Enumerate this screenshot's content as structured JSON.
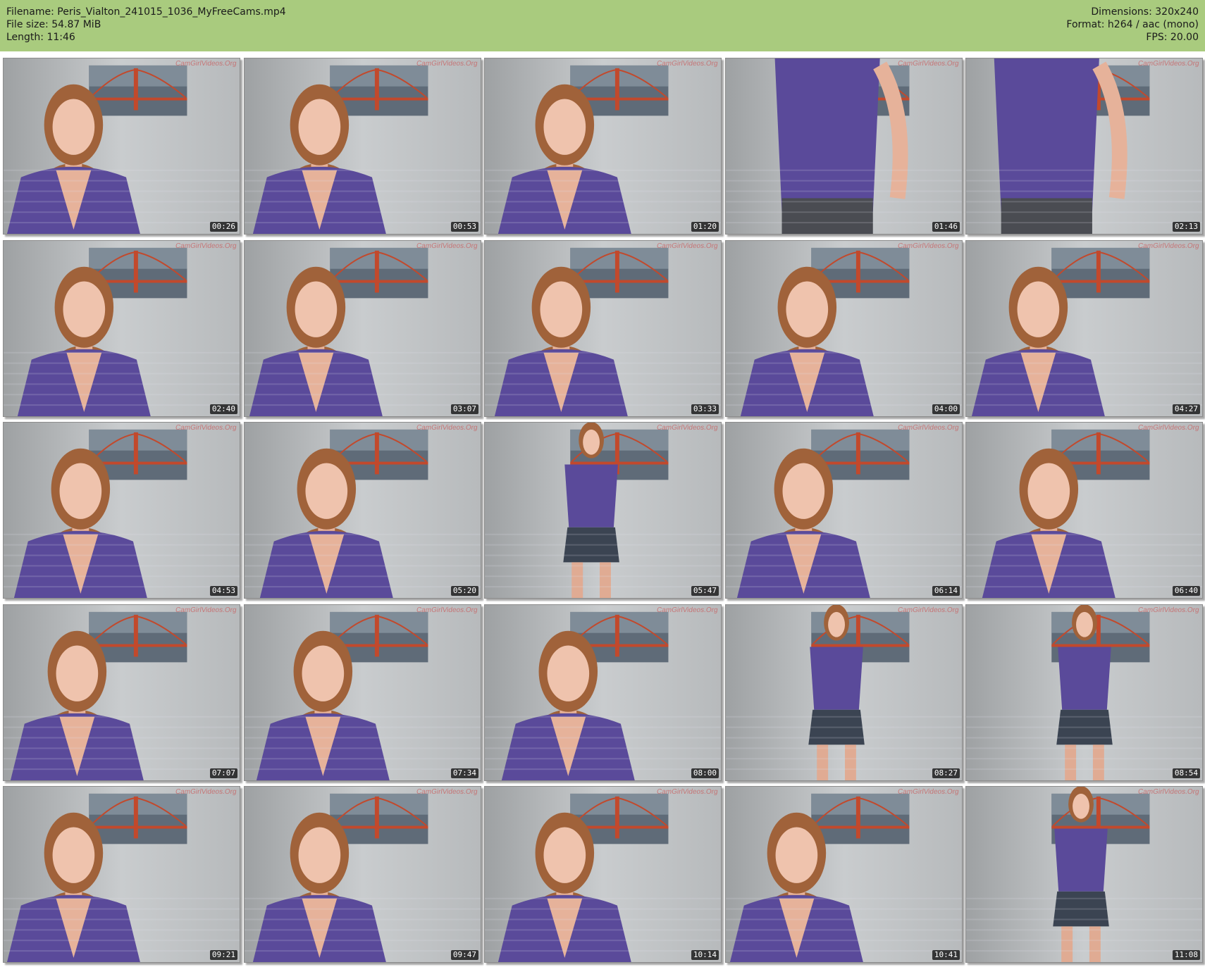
{
  "header": {
    "filename_line": "Filename: Peris_Vialton_241015_1036_MyFreeCams.mp4",
    "filesize_line": "File size: 54.87 MiB",
    "length_line": "Length: 11:46",
    "dimensions_line": "Dimensions: 320x240",
    "format_line": "Format: h264 / aac (mono)",
    "fps_line": "FPS: 20.00"
  },
  "colors": {
    "header_bg": "#a9cb7e",
    "shirt_purple": "#5a4a9a",
    "wall": "#c9ccce",
    "hair": "#a0623a"
  },
  "watermark": "CamGirlVideos.Org",
  "thumbnails": [
    {
      "time": "00:26",
      "pose": "seated"
    },
    {
      "time": "00:53",
      "pose": "seated"
    },
    {
      "time": "01:20",
      "pose": "seated"
    },
    {
      "time": "01:46",
      "pose": "standing-close"
    },
    {
      "time": "02:13",
      "pose": "standing-side"
    },
    {
      "time": "02:40",
      "pose": "seated"
    },
    {
      "time": "03:07",
      "pose": "seated"
    },
    {
      "time": "03:33",
      "pose": "seated"
    },
    {
      "time": "04:00",
      "pose": "seated"
    },
    {
      "time": "04:27",
      "pose": "seated"
    },
    {
      "time": "04:53",
      "pose": "seated"
    },
    {
      "time": "05:20",
      "pose": "seated"
    },
    {
      "time": "05:47",
      "pose": "standing-full"
    },
    {
      "time": "06:14",
      "pose": "seated"
    },
    {
      "time": "06:40",
      "pose": "seated"
    },
    {
      "time": "07:07",
      "pose": "seated"
    },
    {
      "time": "07:34",
      "pose": "seated"
    },
    {
      "time": "08:00",
      "pose": "seated"
    },
    {
      "time": "08:27",
      "pose": "standing-full"
    },
    {
      "time": "08:54",
      "pose": "standing-full"
    },
    {
      "time": "09:21",
      "pose": "seated"
    },
    {
      "time": "09:47",
      "pose": "seated"
    },
    {
      "time": "10:14",
      "pose": "seated"
    },
    {
      "time": "10:41",
      "pose": "seated"
    },
    {
      "time": "11:08",
      "pose": "standing-full"
    }
  ]
}
